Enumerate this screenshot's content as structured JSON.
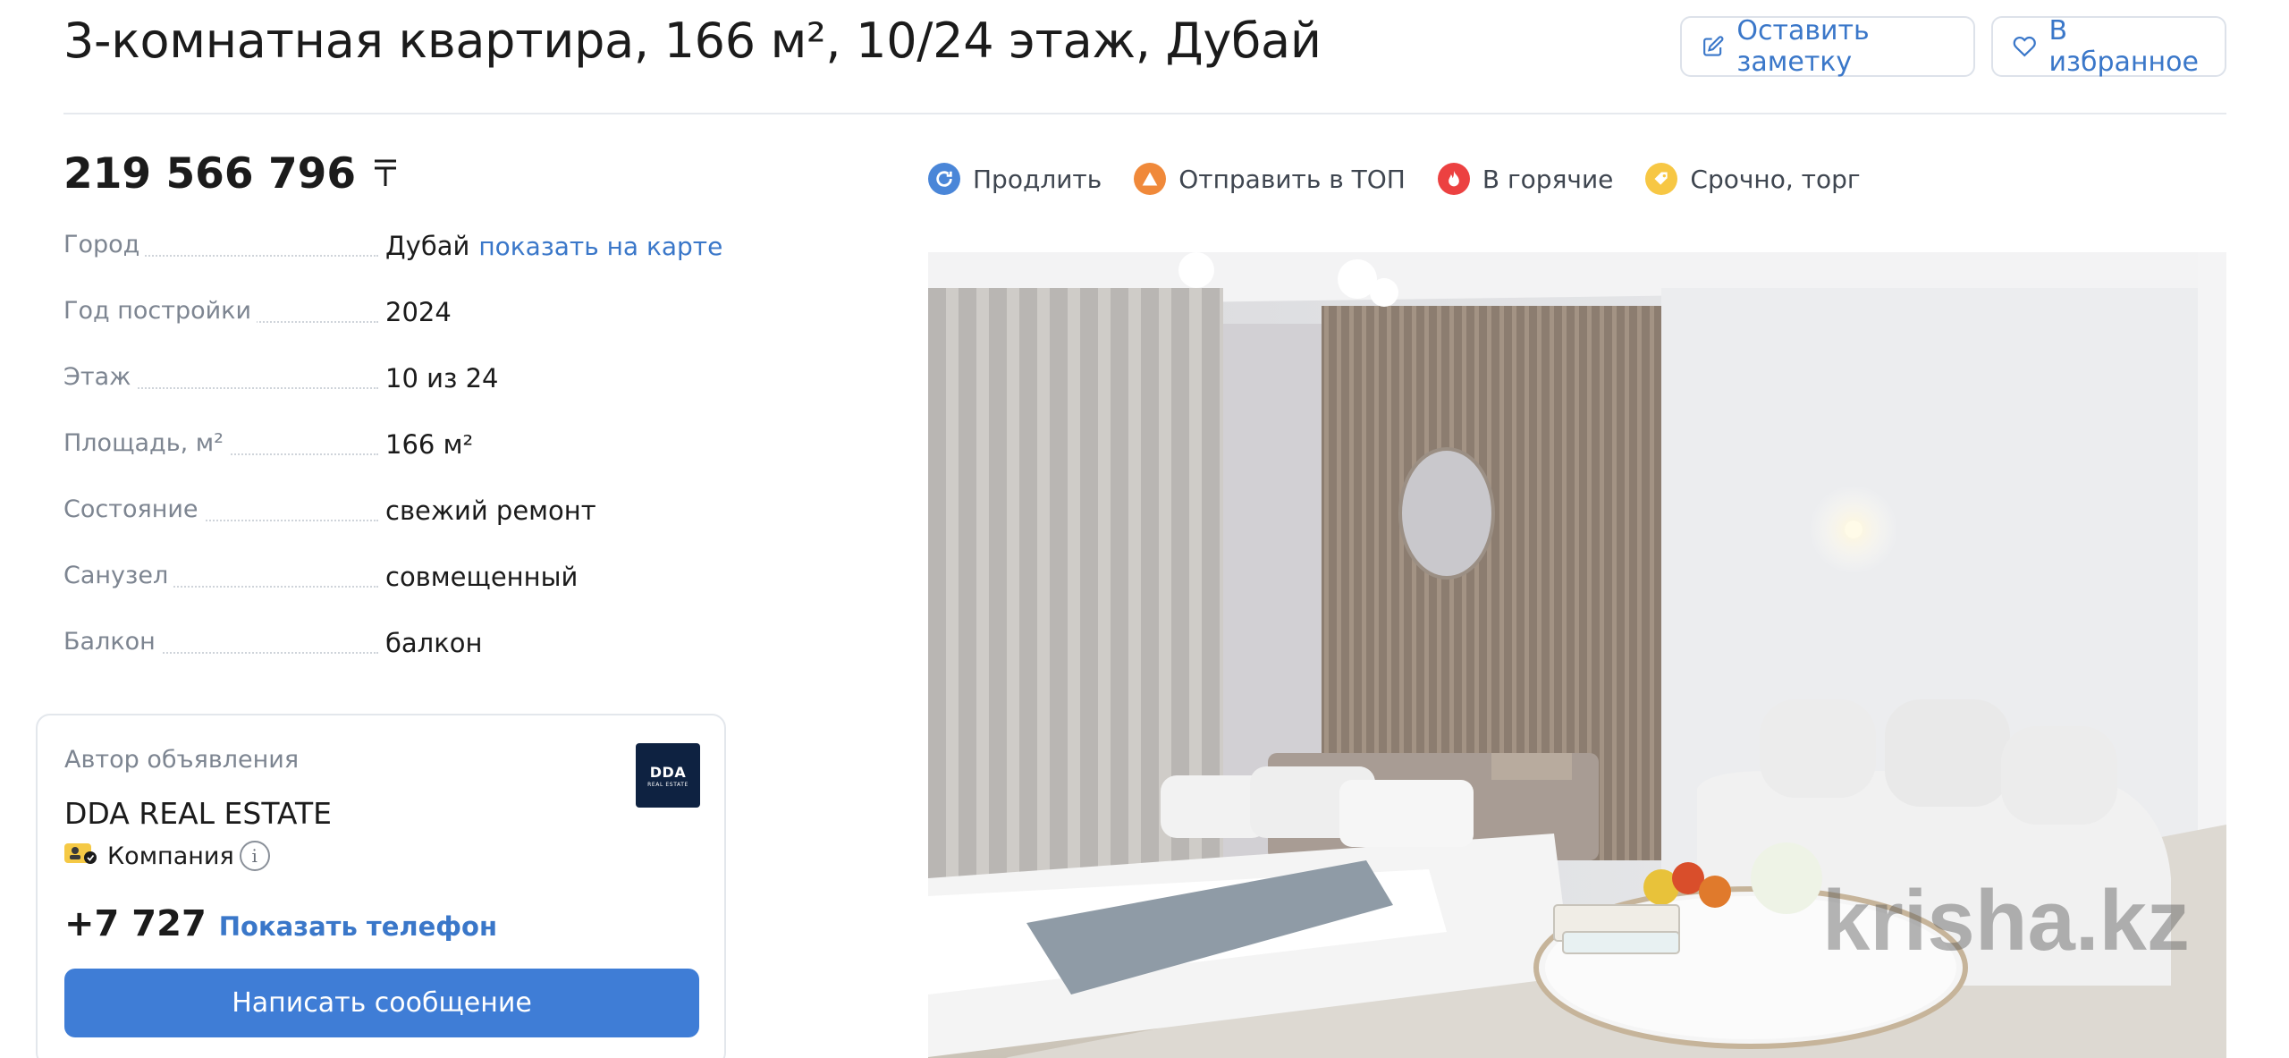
{
  "listing": {
    "title": "3-комнатная квартира, 166 м², 10/24 этаж, Дубай",
    "price": "219 566 796",
    "currency_symbol": "〒"
  },
  "actions": {
    "note_label": "Оставить заметку",
    "favorite_label": "В избранное"
  },
  "params": [
    {
      "label": "Город",
      "value": "Дубай",
      "link": "показать на карте"
    },
    {
      "label": "Год постройки",
      "value": "2024"
    },
    {
      "label": "Этаж",
      "value": "10 из 24"
    },
    {
      "label": "Площадь, м²",
      "value": "166 м²"
    },
    {
      "label": "Состояние",
      "value": "свежий ремонт"
    },
    {
      "label": "Санузел",
      "value": "совмещенный"
    },
    {
      "label": "Балкон",
      "value": "балкон"
    }
  ],
  "services": [
    {
      "label": "Продлить",
      "icon": "renew-icon",
      "color": "#4a86d8"
    },
    {
      "label": "Отправить в ТОП",
      "icon": "top-icon",
      "color": "#f0893a"
    },
    {
      "label": "В горячие",
      "icon": "fire-icon",
      "color": "#ec4141"
    },
    {
      "label": "Срочно, торг",
      "icon": "tag-icon",
      "color": "#f7c744"
    }
  ],
  "photo": {
    "watermark": "krisha.kz"
  },
  "author": {
    "label": "Автор объявления",
    "name": "DDA REAL ESTATE",
    "type": "Компания",
    "info_glyph": "i",
    "logo_text": "DDA",
    "logo_subtext": "REAL ESTATE",
    "phone": "+7 727",
    "show_phone_label": "Показать телефон",
    "message_label": "Написать сообщение"
  },
  "colors": {
    "accent": "#3a77c9",
    "button": "#3f7dd6",
    "muted": "#7d8591"
  }
}
